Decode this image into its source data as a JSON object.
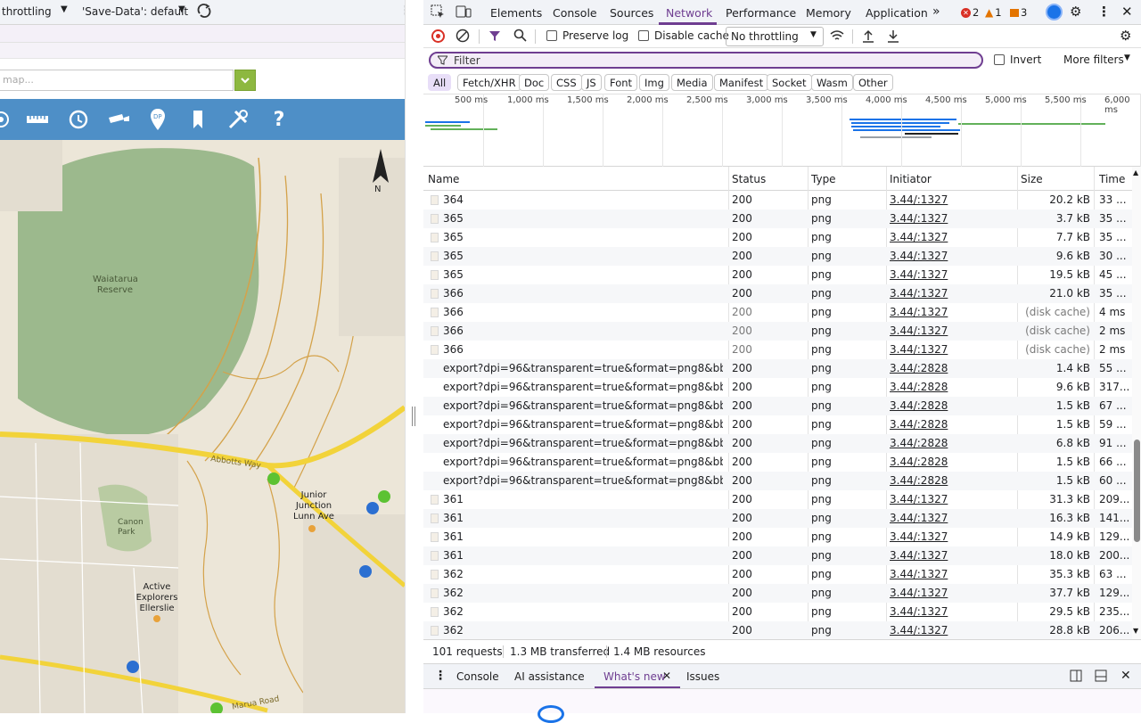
{
  "page_side": {
    "throttle_label": "throttling",
    "save_data_label": "'Save-Data': default",
    "map_search_placeholder": "map...",
    "map_labels": [
      "Waiatarua Reserve",
      "Junior Junction Lunn Ave",
      "Active Explorers Ellerslie",
      "Canon Park",
      "Abbotts Way",
      "Marua Road"
    ],
    "north_label": "N"
  },
  "devtools": {
    "tabs": [
      "Elements",
      "Console",
      "Sources",
      "Network",
      "Performance",
      "Memory",
      "Application"
    ],
    "active_tab": "Network",
    "badges": {
      "errors": "2",
      "warnings": "1",
      "info": "3"
    },
    "toolbar": {
      "preserve_log": "Preserve log",
      "disable_cache": "Disable cache",
      "throttle": "No throttling"
    },
    "filter_placeholder": "Filter",
    "invert": "Invert",
    "more_filters": "More filters",
    "type_filters": [
      "All",
      "Fetch/XHR",
      "Doc",
      "CSS",
      "JS",
      "Font",
      "Img",
      "Media",
      "Manifest",
      "Socket",
      "Wasm",
      "Other"
    ],
    "active_type": "All",
    "timeline_ticks": [
      "500 ms",
      "1,000 ms",
      "1,500 ms",
      "2,000 ms",
      "2,500 ms",
      "3,000 ms",
      "3,500 ms",
      "4,000 ms",
      "4,500 ms",
      "5,000 ms",
      "5,500 ms",
      "6,000 ms"
    ],
    "columns": [
      "Name",
      "Status",
      "Type",
      "Initiator",
      "Size",
      "Time"
    ],
    "rows": [
      {
        "name": "364",
        "status": "200",
        "type": "png",
        "initiator": "3.44/:1327",
        "size": "20.2 kB",
        "time": "33 ..."
      },
      {
        "name": "365",
        "status": "200",
        "type": "png",
        "initiator": "3.44/:1327",
        "size": "3.7 kB",
        "time": "35 ..."
      },
      {
        "name": "365",
        "status": "200",
        "type": "png",
        "initiator": "3.44/:1327",
        "size": "7.7 kB",
        "time": "35 ..."
      },
      {
        "name": "365",
        "status": "200",
        "type": "png",
        "initiator": "3.44/:1327",
        "size": "9.6 kB",
        "time": "30 ..."
      },
      {
        "name": "365",
        "status": "200",
        "type": "png",
        "initiator": "3.44/:1327",
        "size": "19.5 kB",
        "time": "45 ..."
      },
      {
        "name": "366",
        "status": "200",
        "type": "png",
        "initiator": "3.44/:1327",
        "size": "21.0 kB",
        "time": "35 ..."
      },
      {
        "name": "366",
        "status": "200",
        "type": "png",
        "initiator": "3.44/:1327",
        "size": "(disk cache)",
        "time": "4 ms"
      },
      {
        "name": "366",
        "status": "200",
        "type": "png",
        "initiator": "3.44/:1327",
        "size": "(disk cache)",
        "time": "2 ms"
      },
      {
        "name": "366",
        "status": "200",
        "type": "png",
        "initiator": "3.44/:1327",
        "size": "(disk cache)",
        "time": "2 ms"
      },
      {
        "name": "export?dpi=96&transparent=true&format=png8&bbox=...",
        "status": "200",
        "type": "png",
        "initiator": "3.44/:2828",
        "size": "1.4 kB",
        "time": "55 ..."
      },
      {
        "name": "export?dpi=96&transparent=true&format=png8&bbox=...",
        "status": "200",
        "type": "png",
        "initiator": "3.44/:2828",
        "size": "9.6 kB",
        "time": "317..."
      },
      {
        "name": "export?dpi=96&transparent=true&format=png8&bbox=...",
        "status": "200",
        "type": "png",
        "initiator": "3.44/:2828",
        "size": "1.5 kB",
        "time": "67 ..."
      },
      {
        "name": "export?dpi=96&transparent=true&format=png8&bbox=...",
        "status": "200",
        "type": "png",
        "initiator": "3.44/:2828",
        "size": "1.5 kB",
        "time": "59 ..."
      },
      {
        "name": "export?dpi=96&transparent=true&format=png8&bbox=...",
        "status": "200",
        "type": "png",
        "initiator": "3.44/:2828",
        "size": "6.8 kB",
        "time": "91 ..."
      },
      {
        "name": "export?dpi=96&transparent=true&format=png8&bbox=...",
        "status": "200",
        "type": "png",
        "initiator": "3.44/:2828",
        "size": "1.5 kB",
        "time": "66 ..."
      },
      {
        "name": "export?dpi=96&transparent=true&format=png8&bbox=...",
        "status": "200",
        "type": "png",
        "initiator": "3.44/:2828",
        "size": "1.5 kB",
        "time": "60 ..."
      },
      {
        "name": "361",
        "status": "200",
        "type": "png",
        "initiator": "3.44/:1327",
        "size": "31.3 kB",
        "time": "209..."
      },
      {
        "name": "361",
        "status": "200",
        "type": "png",
        "initiator": "3.44/:1327",
        "size": "16.3 kB",
        "time": "141..."
      },
      {
        "name": "361",
        "status": "200",
        "type": "png",
        "initiator": "3.44/:1327",
        "size": "14.9 kB",
        "time": "129..."
      },
      {
        "name": "361",
        "status": "200",
        "type": "png",
        "initiator": "3.44/:1327",
        "size": "18.0 kB",
        "time": "200..."
      },
      {
        "name": "362",
        "status": "200",
        "type": "png",
        "initiator": "3.44/:1327",
        "size": "35.3 kB",
        "time": "63 ..."
      },
      {
        "name": "362",
        "status": "200",
        "type": "png",
        "initiator": "3.44/:1327",
        "size": "37.7 kB",
        "time": "129..."
      },
      {
        "name": "362",
        "status": "200",
        "type": "png",
        "initiator": "3.44/:1327",
        "size": "29.5 kB",
        "time": "235..."
      },
      {
        "name": "362",
        "status": "200",
        "type": "png",
        "initiator": "3.44/:1327",
        "size": "28.8 kB",
        "time": "206..."
      }
    ],
    "status": {
      "requests": "101 requests",
      "transferred": "1.3 MB transferred",
      "resources": "1.4 MB resources"
    },
    "drawer_tabs": [
      "Console",
      "AI assistance",
      "What's new",
      "Issues"
    ],
    "active_drawer": "What's new"
  },
  "colors": {
    "accent": "#6f3e91",
    "map_toolbar": "#4e8fc7",
    "map_go": "#8db840",
    "error": "#d93025",
    "warning": "#e37400"
  }
}
